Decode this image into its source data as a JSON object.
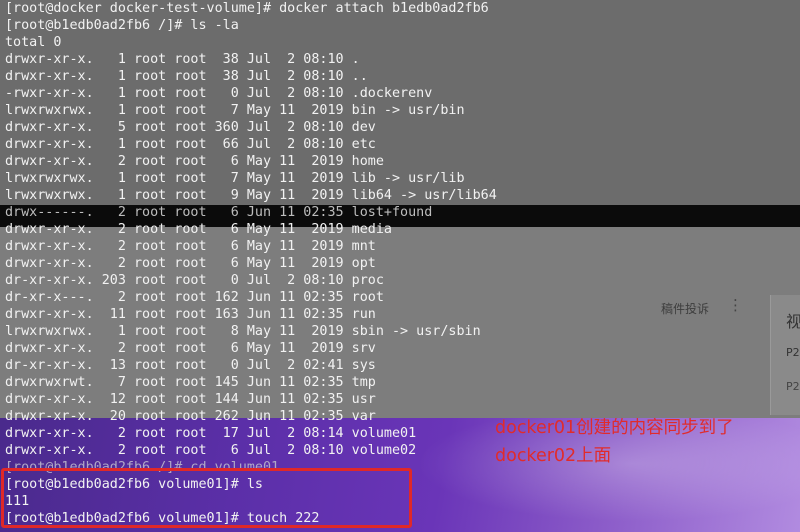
{
  "terminal": {
    "lines": [
      "[root@docker docker-test-volume]# docker attach b1edb0ad2fb6",
      "[root@b1edb0ad2fb6 /]# ls -la",
      "total 0",
      "drwxr-xr-x.   1 root root  38 Jul  2 08:10 .",
      "drwxr-xr-x.   1 root root  38 Jul  2 08:10 ..",
      "-rwxr-xr-x.   1 root root   0 Jul  2 08:10 .dockerenv",
      "lrwxrwxrwx.   1 root root   7 May 11  2019 bin -> usr/bin",
      "drwxr-xr-x.   5 root root 360 Jul  2 08:10 dev",
      "drwxr-xr-x.   1 root root  66 Jul  2 08:10 etc",
      "drwxr-xr-x.   2 root root   6 May 11  2019 home",
      "lrwxrwxrwx.   1 root root   7 May 11  2019 lib -> usr/lib",
      "lrwxrwxrwx.   1 root root   9 May 11  2019 lib64 -> usr/lib64",
      "drwx------.   2 root root   6 Jun 11 02:35 lost+found",
      "drwxr-xr-x.   2 root root   6 May 11  2019 media",
      "drwxr-xr-x.   2 root root   6 May 11  2019 mnt",
      "drwxr-xr-x.   2 root root   6 May 11  2019 opt",
      "dr-xr-xr-x. 203 root root   0 Jul  2 08:10 proc",
      "dr-xr-x---.   2 root root 162 Jun 11 02:35 root",
      "drwxr-xr-x.  11 root root 163 Jun 11 02:35 run",
      "lrwxrwxrwx.   1 root root   8 May 11  2019 sbin -> usr/sbin",
      "drwxr-xr-x.   2 root root   6 May 11  2019 srv",
      "dr-xr-xr-x.  13 root root   0 Jul  2 02:41 sys",
      "drwxrwxrwt.   7 root root 145 Jun 11 02:35 tmp",
      "drwxr-xr-x.  12 root root 144 Jun 11 02:35 usr",
      "drwxr-xr-x.  20 root root 262 Jun 11 02:35 var",
      "drwxr-xr-x.   2 root root  17 Jul  2 08:14 volume01",
      "drwxr-xr-x.   2 root root   6 Jul  2 08:10 volume02",
      "[root@b1edb0ad2fb6 /]# cd volume01",
      "[root@b1edb0ad2fb6 volume01]# ls",
      "111",
      "[root@b1edb0ad2fb6 volume01]# touch 222"
    ]
  },
  "annotation": {
    "line1": "docker01创建的内容同步到了",
    "line2": "docker02上面",
    "color": "#e12b2b"
  },
  "overlay": {
    "report_label": "稿件投诉",
    "menu_glyph": "⋮",
    "side_text": "视",
    "p1": "P2",
    "p2": "P2"
  }
}
